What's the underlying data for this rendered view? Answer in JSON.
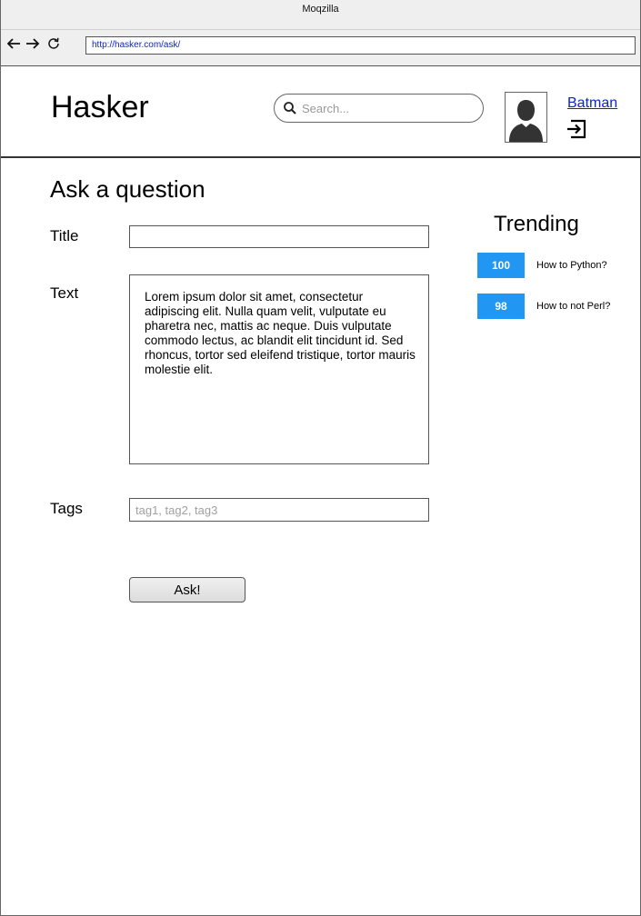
{
  "browser": {
    "window_title": "Moqzilla",
    "url": "http://hasker.com/ask/",
    "back_icon": "arrow-left",
    "forward_icon": "arrow-right",
    "reload_icon": "reload"
  },
  "header": {
    "logo": "Hasker",
    "search_placeholder": "Search...",
    "username": "Batman",
    "avatar_icon": "user-silhouette",
    "logout_icon": "sign-out"
  },
  "main": {
    "page_title": "Ask a question",
    "title_label": "Title",
    "title_value": "",
    "text_label": "Text",
    "text_value": "Lorem ipsum dolor sit amet, consectetur adipiscing elit. Nulla quam velit, vulputate eu pharetra nec, mattis ac neque. Duis vulputate commodo lectus, ac blandit elit tincidunt id. Sed rhoncus, tortor sed eleifend tristique, tortor mauris molestie elit.",
    "tags_label": "Tags",
    "tags_placeholder": "tag1, tag2, tag3",
    "tags_value": "",
    "submit_label": "Ask!"
  },
  "sidebar": {
    "title": "Trending",
    "items": [
      {
        "score": "100",
        "label": "How to Python?"
      },
      {
        "score": "98",
        "label": "How to not Perl?"
      }
    ]
  },
  "colors": {
    "accent": "#2196f3",
    "link": "#0a24d6"
  }
}
